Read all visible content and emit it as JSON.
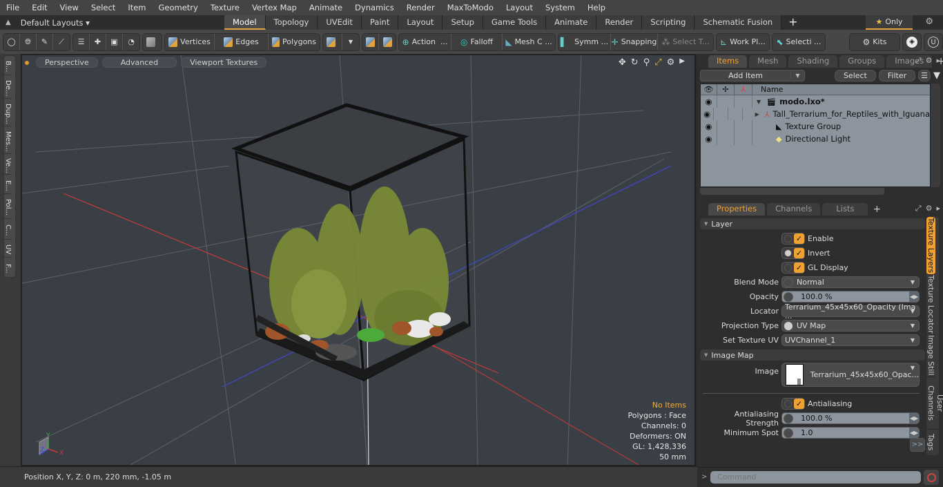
{
  "menu": [
    "File",
    "Edit",
    "View",
    "Select",
    "Item",
    "Geometry",
    "Texture",
    "Vertex Map",
    "Animate",
    "Dynamics",
    "Render",
    "MaxToModo",
    "Layout",
    "System",
    "Help"
  ],
  "layoutbar": {
    "layout_select": "Default Layouts ▾",
    "tabs": [
      "Model",
      "Topology",
      "UVEdit",
      "Paint",
      "Layout",
      "Setup",
      "Game Tools",
      "Animate",
      "Render",
      "Scripting",
      "Schematic Fusion"
    ],
    "active_tab": "Model",
    "add_tab": "+",
    "only_label": "Only"
  },
  "toolbar": {
    "vertices": "Vertices",
    "edges": "Edges",
    "polygons": "Polygons",
    "action": "Action",
    "action_more": "...",
    "falloff": "Falloff",
    "mesh_c": "Mesh C ...",
    "symm": "Symm ...",
    "snapping": "Snapping",
    "select_t": "Select T...",
    "work_pl": "Work Pl...",
    "selecti": "Selecti ...",
    "kits": "Kits"
  },
  "left_tabs": [
    "B...",
    "De...",
    "Dup...",
    "Mes...",
    "Ve...",
    "E...",
    "Pol...",
    "C...",
    "UV",
    "F..."
  ],
  "viewport": {
    "view_mode": "Perspective",
    "shading": "Advanced",
    "textures": "Viewport Textures",
    "stats": {
      "selection": "No Items",
      "polygons": "Polygons : Face",
      "channels": "Channels: 0",
      "deformers": "Deformers: ON",
      "gl": "GL: 1,428,336",
      "scale": "50 mm"
    },
    "axis_labels": {
      "x": "X",
      "y": "Y",
      "z": "Z"
    }
  },
  "status": {
    "position": "Position X, Y, Z:   0 m, 220 mm, -1.05 m"
  },
  "items_panel": {
    "tabs": [
      "Items",
      "Mesh ...",
      "Shading",
      "Groups",
      "Images"
    ],
    "active_tab": "Items",
    "add_item": "Add Item",
    "select": "Select",
    "filter": "Filter",
    "name_header": "Name",
    "tree": [
      {
        "name": "modo.lxo*",
        "icon": "scene-icon",
        "level": 0,
        "bold": true,
        "expand": "▼"
      },
      {
        "name": "Tall_Terrarium_for_Reptiles_with_Iguana",
        "icon": "mesh-locator-icon",
        "level": 1,
        "bold": false,
        "expand": "▶"
      },
      {
        "name": "Texture Group",
        "icon": "texture-group-icon",
        "level": 1,
        "bold": false,
        "expand": ""
      },
      {
        "name": "Directional Light",
        "icon": "light-icon",
        "level": 1,
        "bold": false,
        "expand": ""
      }
    ]
  },
  "properties_panel": {
    "tabs": [
      "Properties",
      "Channels",
      "Lists"
    ],
    "active_tab": "Properties",
    "layer_section": "Layer",
    "enable": {
      "label": "Enable",
      "checked": true
    },
    "invert": {
      "label": "Invert",
      "checked": true
    },
    "gl_display": {
      "label": "GL Display",
      "checked": true
    },
    "blend_mode": {
      "label": "Blend Mode",
      "value": "Normal"
    },
    "opacity": {
      "label": "Opacity",
      "value": "100.0 %"
    },
    "locator": {
      "label": "Locator",
      "value": "Terrarium_45x45x60_Opacity (Ima ..."
    },
    "projection_type": {
      "label": "Projection Type",
      "value": "UV Map"
    },
    "set_texture_uv": {
      "label": "Set Texture UV",
      "value": "UVChannel_1"
    },
    "image_map_section": "Image Map",
    "image": {
      "label": "Image",
      "value": "Terrarium_45x45x60_Opac..."
    },
    "antialiasing": {
      "label": "Antialiasing",
      "checked": true
    },
    "antialiasing_strength": {
      "label": "Antialiasing Strength",
      "value": "100.0 %"
    },
    "minimum_spot": {
      "label": "Minimum Spot",
      "value": "1.0"
    },
    "more": ">>",
    "side_tabs": [
      "Texture Layers",
      "Texture Locator",
      "Image Still",
      "User Channels",
      "Tags"
    ],
    "active_side_tab": "Texture Layers"
  },
  "command": {
    "prompt": ">",
    "placeholder": "Command"
  },
  "colors": {
    "accent": "#f0a134",
    "viewport_bg": "#3a3f45",
    "axis_x": "#c83a3a",
    "axis_y": "#3fae3f",
    "axis_z": "#3a4ad0"
  }
}
